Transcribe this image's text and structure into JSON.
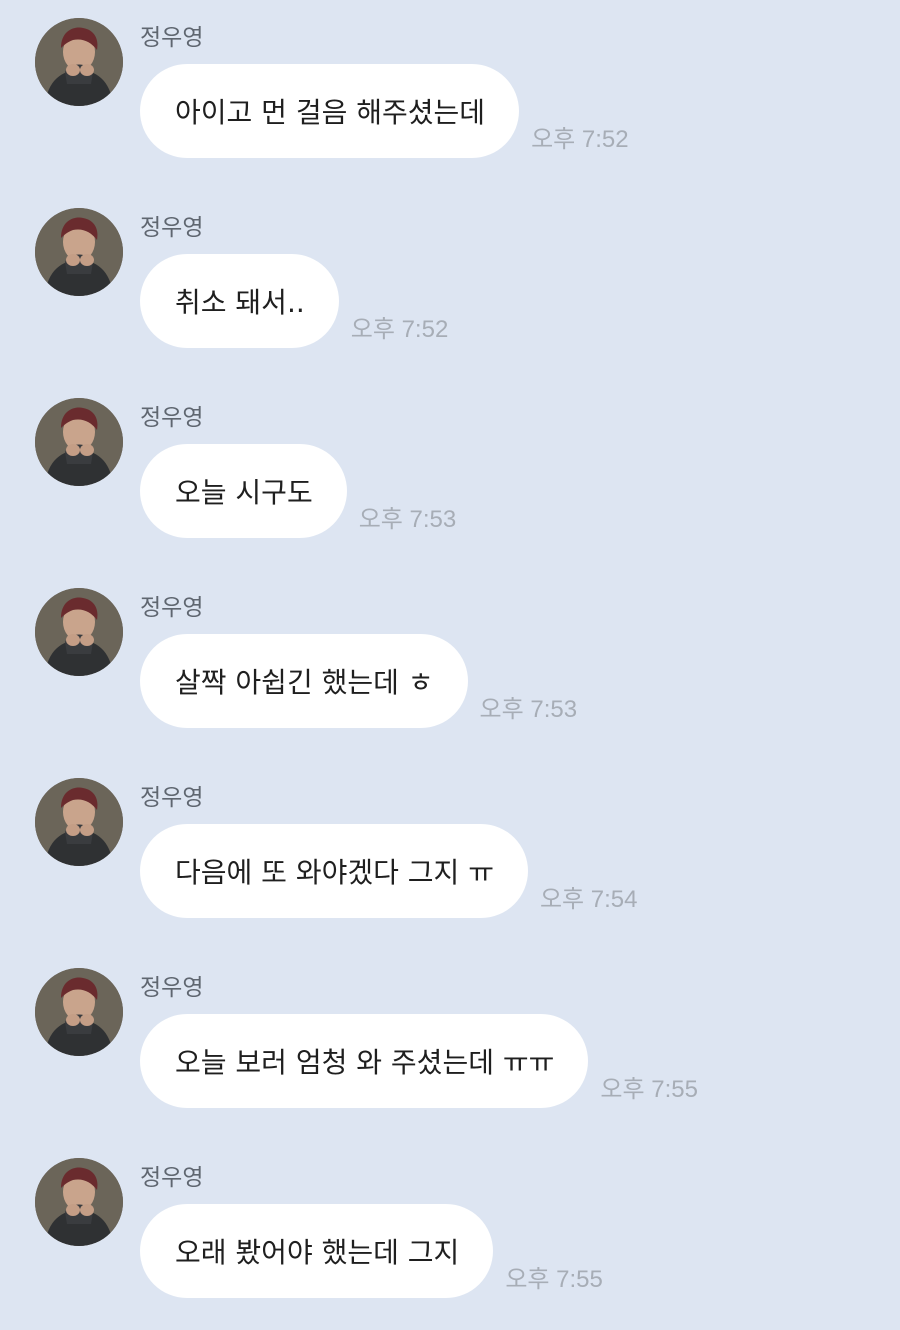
{
  "messages": [
    {
      "sender": "정우영",
      "text": "아이고 먼 걸음 해주셨는데",
      "time": "오후 7:52"
    },
    {
      "sender": "정우영",
      "text": "취소 돼서..",
      "time": "오후 7:52"
    },
    {
      "sender": "정우영",
      "text": "오늘 시구도",
      "time": "오후 7:53"
    },
    {
      "sender": "정우영",
      "text": "살짝 아쉽긴 했는데 ㅎ",
      "time": "오후 7:53"
    },
    {
      "sender": "정우영",
      "text": "다음에 또 와야겠다 그지 ㅠ",
      "time": "오후 7:54"
    },
    {
      "sender": "정우영",
      "text": "오늘 보러 엄청 와 주셨는데 ㅠㅠ",
      "time": "오후 7:55"
    },
    {
      "sender": "정우영",
      "text": "오래 봤어야 했는데 그지",
      "time": "오후 7:55"
    }
  ],
  "colors": {
    "background": "#dde5f2",
    "bubble": "#ffffff",
    "sender_text": "#5f6670",
    "time_text": "#a7adb6"
  },
  "icons": {
    "avatar": "profile-photo"
  }
}
